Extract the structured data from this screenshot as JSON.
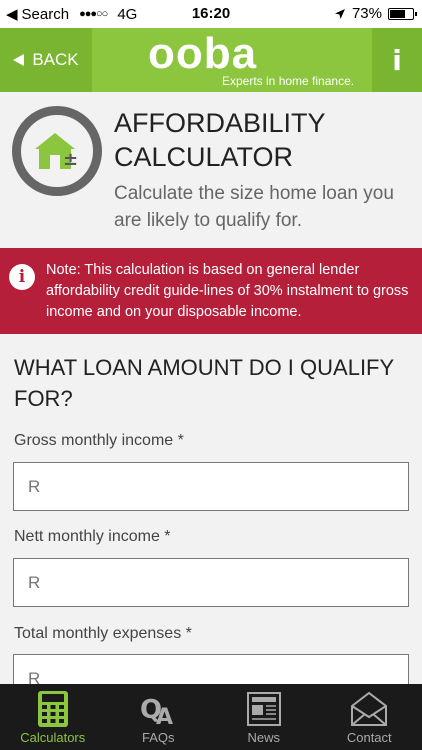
{
  "status_bar": {
    "back_app": "Search",
    "carrier": "4G",
    "signal": "●●●○○",
    "time": "16:20",
    "battery": "73%",
    "battery_level": 0.73
  },
  "header": {
    "back_label": "BACK",
    "logo": "ooba",
    "tagline": "Experts in home finance.",
    "info_label": "i"
  },
  "title": {
    "line1": "AFFORDABILITY",
    "line2": "CALCULATOR",
    "subtitle": "Calculate the size home loan you are likely to qualify for."
  },
  "note": {
    "icon": "i",
    "text": "Note: This calculation is based on general lender affordability credit guide-lines of 30% instalment to gross income and on your disposable income."
  },
  "form": {
    "heading": "WHAT LOAN AMOUNT DO I QUALIFY FOR?",
    "fields": [
      {
        "label": "Gross monthly income *",
        "placeholder": "R"
      },
      {
        "label": "Nett monthly income *",
        "placeholder": "R"
      },
      {
        "label": "Total monthly expenses *",
        "placeholder": "R"
      }
    ]
  },
  "tabs": [
    {
      "label": "Calculators",
      "icon": "calculator-icon"
    },
    {
      "label": "FAQs",
      "icon": "qa-icon"
    },
    {
      "label": "News",
      "icon": "newspaper-icon"
    },
    {
      "label": "Contact",
      "icon": "envelope-icon"
    }
  ],
  "colors": {
    "brand_green": "#8cc63f",
    "alert_red": "#b51f3a",
    "tab_bar": "#1a1a1a"
  }
}
